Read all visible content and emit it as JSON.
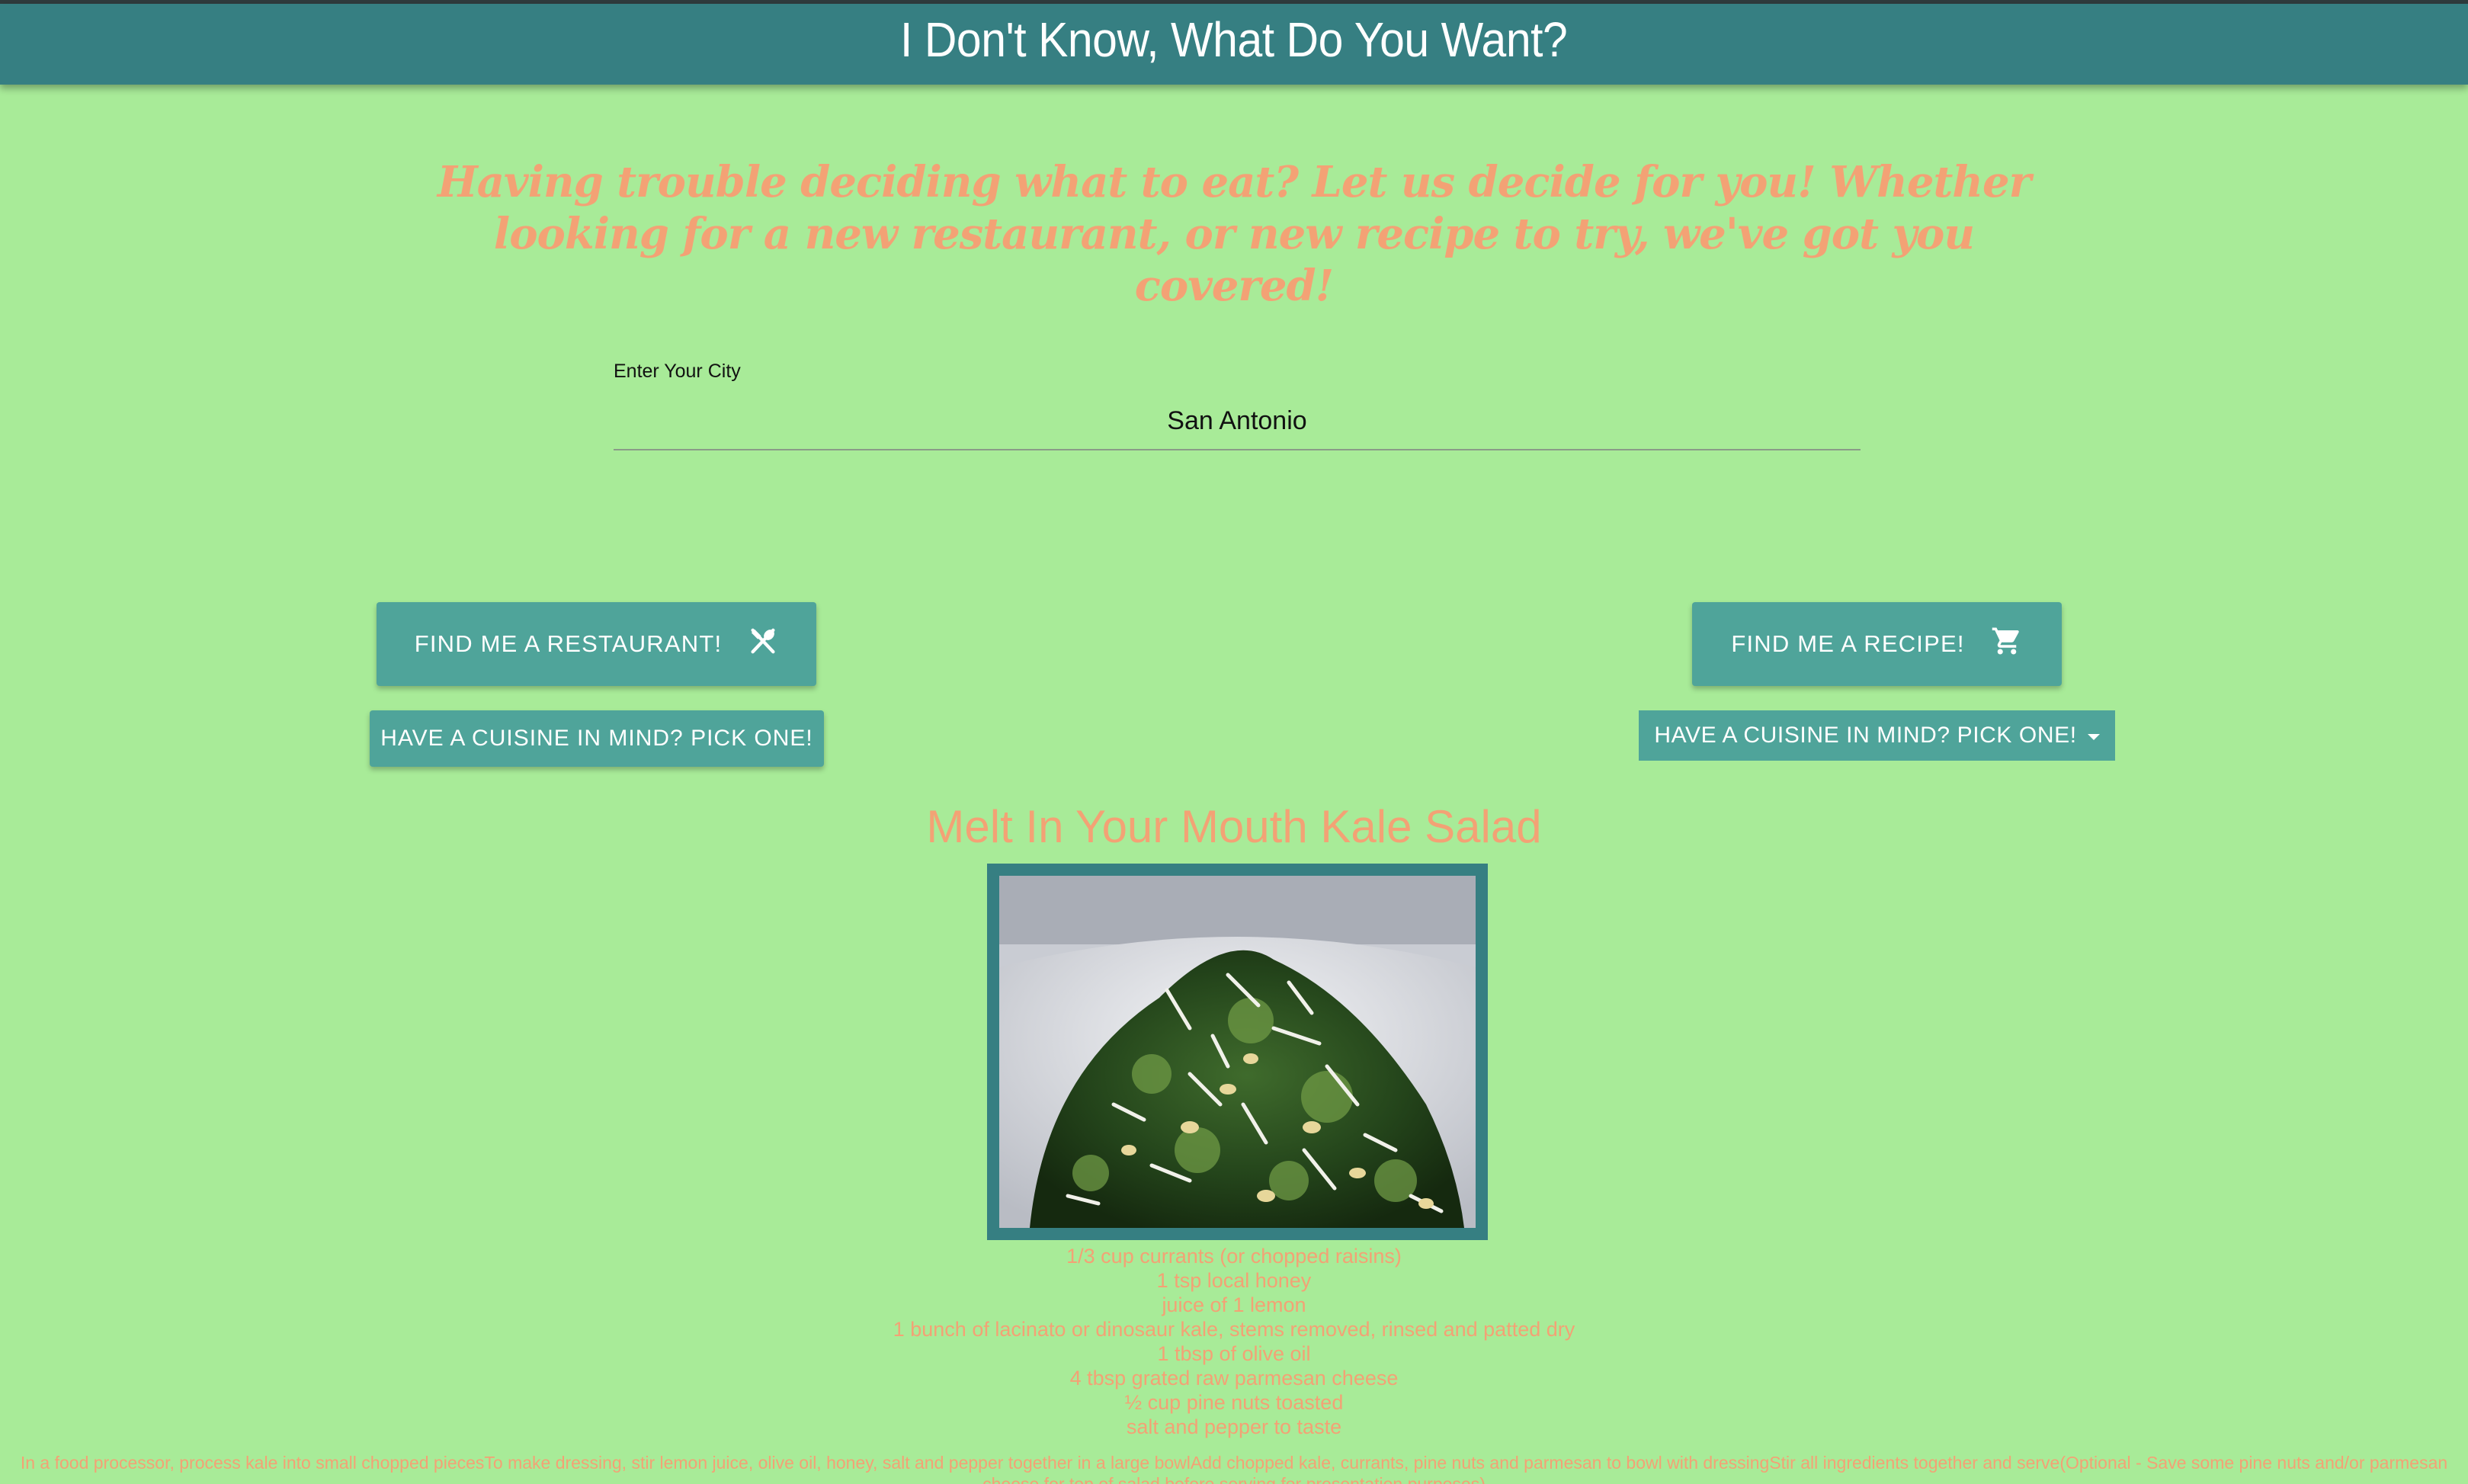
{
  "header": {
    "title": "I Don't Know, What Do You Want?"
  },
  "tagline": "Having trouble deciding what to eat? Let us decide for you! Whether looking for a new restaurant, or new recipe to try, we've got you covered!",
  "city": {
    "label": "Enter Your City",
    "value": "San Antonio"
  },
  "buttons": {
    "restaurant": "FIND ME A RESTAURANT!",
    "recipe": "FIND ME A RECIPE!",
    "cuisine_left": "HAVE A CUISINE IN MIND? PICK ONE!",
    "cuisine_right": "HAVE A CUISINE IN MIND? PICK ONE!"
  },
  "icons": {
    "restaurant": "fork-spoon-icon",
    "recipe": "shopping-cart-icon",
    "dropdown": "caret-down-icon"
  },
  "recipe": {
    "title": "Melt In Your Mouth Kale Salad",
    "image": "kale-salad-photo",
    "ingredients": [
      "1/3 cup currants (or chopped raisins)",
      "1 tsp local honey",
      "juice of 1 lemon",
      "1 bunch of lacinato or dinosaur kale, stems removed, rinsed and patted dry",
      "1 tbsp of olive oil",
      "4 tbsp grated raw parmesan cheese",
      "½ cup pine nuts toasted",
      "salt and pepper to taste"
    ],
    "instructions": "In a food processor, process kale into small chopped piecesTo make dressing, stir lemon juice, olive oil, honey, salt and pepper together in a large bowlAdd chopped kale, currants, pine nuts and parmesan to bowl with dressingStir all ingredients together and serve(Optional - Save some pine nuts and/or parmesan cheese for top of salad before serving for presentation purposes)"
  },
  "colors": {
    "background": "#a8eb98",
    "header": "#367f82",
    "button": "#4fa49a",
    "accent_text": "#f3a275"
  }
}
